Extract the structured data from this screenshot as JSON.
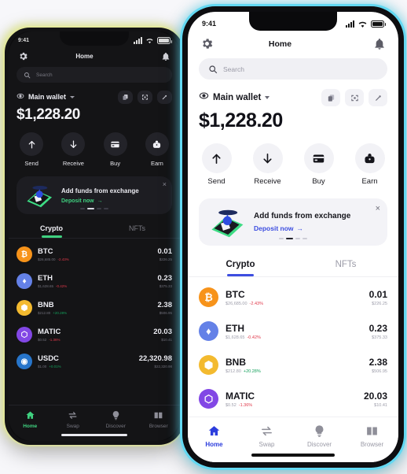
{
  "statusbar": {
    "time": "9:41"
  },
  "header": {
    "title": "Home",
    "gear_icon": "gear-icon",
    "bell_icon": "bell-icon"
  },
  "search": {
    "placeholder": "Search",
    "icon": "search-icon"
  },
  "wallet": {
    "name": "Main wallet",
    "eye_icon": "eye-icon",
    "balance": "$1,228.20",
    "actions_icons": [
      "copy-icon",
      "scan-icon",
      "link-icon"
    ]
  },
  "quick_actions": [
    {
      "label": "Send",
      "icon": "arrow-up-icon"
    },
    {
      "label": "Receive",
      "icon": "arrow-down-icon"
    },
    {
      "label": "Buy",
      "icon": "card-icon"
    },
    {
      "label": "Earn",
      "icon": "piggy-bank-icon"
    }
  ],
  "banner": {
    "title": "Add funds from exchange",
    "link": "Deposit now",
    "arrow": "→",
    "close": "×",
    "link_color_light": "#3d4ee0",
    "link_color_dark": "#3fd07f"
  },
  "tabs": [
    {
      "label": "Crypto",
      "active": true
    },
    {
      "label": "NFTs",
      "active": false
    }
  ],
  "assets": [
    {
      "symbol": "BTC",
      "price": "$26,685.00",
      "change": "-2.43%",
      "dir": "down",
      "amount": "0.01",
      "fiat": "$226.25",
      "color": "#f7931a",
      "glyph": "₿"
    },
    {
      "symbol": "ETH",
      "price": "$1,628.65",
      "change": "-0.42%",
      "dir": "down",
      "amount": "0.23",
      "fiat": "$375.33",
      "color": "#6481e7",
      "glyph": "♦"
    },
    {
      "symbol": "BNB",
      "price": "$212.80",
      "change": "+20.28%",
      "dir": "up",
      "amount": "2.38",
      "fiat": "$506.95",
      "color": "#f3ba2f",
      "glyph": "⬢"
    },
    {
      "symbol": "MATIC",
      "price": "$0.52",
      "change": "-1.36%",
      "dir": "down",
      "amount": "20.03",
      "fiat": "$10.41",
      "color": "#8247e5",
      "glyph": "⬡"
    },
    {
      "symbol": "USDC",
      "price": "$1.00",
      "change": "+0.01%",
      "dir": "up",
      "amount": "22,320.98",
      "fiat": "$22,320.98",
      "color": "#2775ca",
      "glyph": "◉"
    }
  ],
  "bottom_nav": [
    {
      "label": "Home",
      "icon": "home-icon",
      "active": true
    },
    {
      "label": "Swap",
      "icon": "swap-icon",
      "active": false
    },
    {
      "label": "Discover",
      "icon": "bulb-icon",
      "active": false
    },
    {
      "label": "Browser",
      "icon": "book-icon",
      "active": false
    }
  ],
  "theme": {
    "light_bg": "#ffffff",
    "dark_bg": "#141416",
    "accent_light": "#3d4ee0",
    "accent_dark": "#3fd07f",
    "page_bg": "#f7f7fa"
  }
}
